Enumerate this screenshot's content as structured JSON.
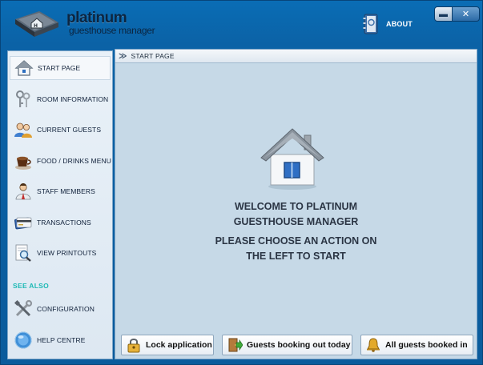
{
  "app": {
    "logo_line1": "platinum",
    "logo_line2": "guesthouse manager",
    "about_label": "ABOUT",
    "minimize_glyph": "▬",
    "close_glyph": "✕"
  },
  "sidebar": {
    "items": [
      {
        "label": "START PAGE",
        "icon": "house-icon"
      },
      {
        "label": "ROOM INFORMATION",
        "icon": "keys-icon"
      },
      {
        "label": "CURRENT GUESTS",
        "icon": "people-icon"
      },
      {
        "label": "FOOD / DRINKS MENU",
        "icon": "coffee-cup-icon"
      },
      {
        "label": "STAFF MEMBERS",
        "icon": "staff-icon"
      },
      {
        "label": "TRANSACTIONS",
        "icon": "credit-card-icon"
      },
      {
        "label": "VIEW PRINTOUTS",
        "icon": "magnifier-document-icon"
      }
    ],
    "see_also_label": "SEE ALSO",
    "see_also_items": [
      {
        "label": "CONFIGURATION",
        "icon": "tools-icon"
      },
      {
        "label": "HELP CENTRE",
        "icon": "help-globe-icon"
      }
    ]
  },
  "main": {
    "breadcrumb_glyph": "≫",
    "breadcrumb_label": "START PAGE",
    "welcome_line1": "WELCOME TO PLATINUM",
    "welcome_line2": "GUESTHOUSE MANAGER",
    "instruction_line1": "PLEASE CHOOSE AN ACTION ON",
    "instruction_line2": "THE LEFT TO START"
  },
  "actions": {
    "lock_label": "Lock application",
    "booking_out_label": "Guests booking out today",
    "booked_in_label": "All guests booked in"
  },
  "colors": {
    "window_blue": "#0b62a6",
    "panel_light": "#e9f1f8",
    "main_bg": "#c6d9e7",
    "see_also_accent": "#1db9b5"
  }
}
